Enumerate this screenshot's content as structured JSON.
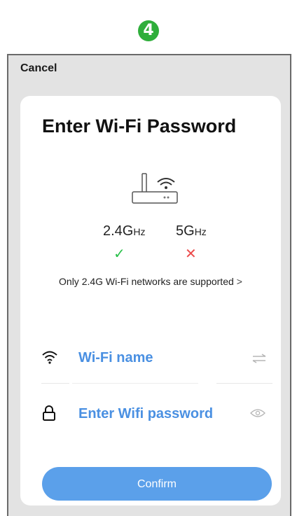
{
  "step_number": "4",
  "header": {
    "cancel_label": "Cancel"
  },
  "card": {
    "title": "Enter Wi-Fi Password",
    "bands": [
      {
        "main": "2.4G",
        "unit": "Hz",
        "status": "✓",
        "supported": true
      },
      {
        "main": "5G",
        "unit": "Hz",
        "status": "✕",
        "supported": false
      }
    ],
    "notice": "Only 2.4G Wi-Fi networks are supported",
    "notice_chevron": ">",
    "wifi_name_placeholder": "Wi-Fi name",
    "password_placeholder": "Enter Wifi password",
    "confirm_label": "Confirm"
  },
  "colors": {
    "accent": "#4a90e2",
    "button": "#5ba0ea",
    "ok": "#29c14a",
    "error": "#ec4b4b",
    "badge": "#2fae3b"
  },
  "icons": [
    "wifi-icon",
    "lock-icon",
    "switch-network-icon",
    "eye-icon",
    "router-icon"
  ]
}
